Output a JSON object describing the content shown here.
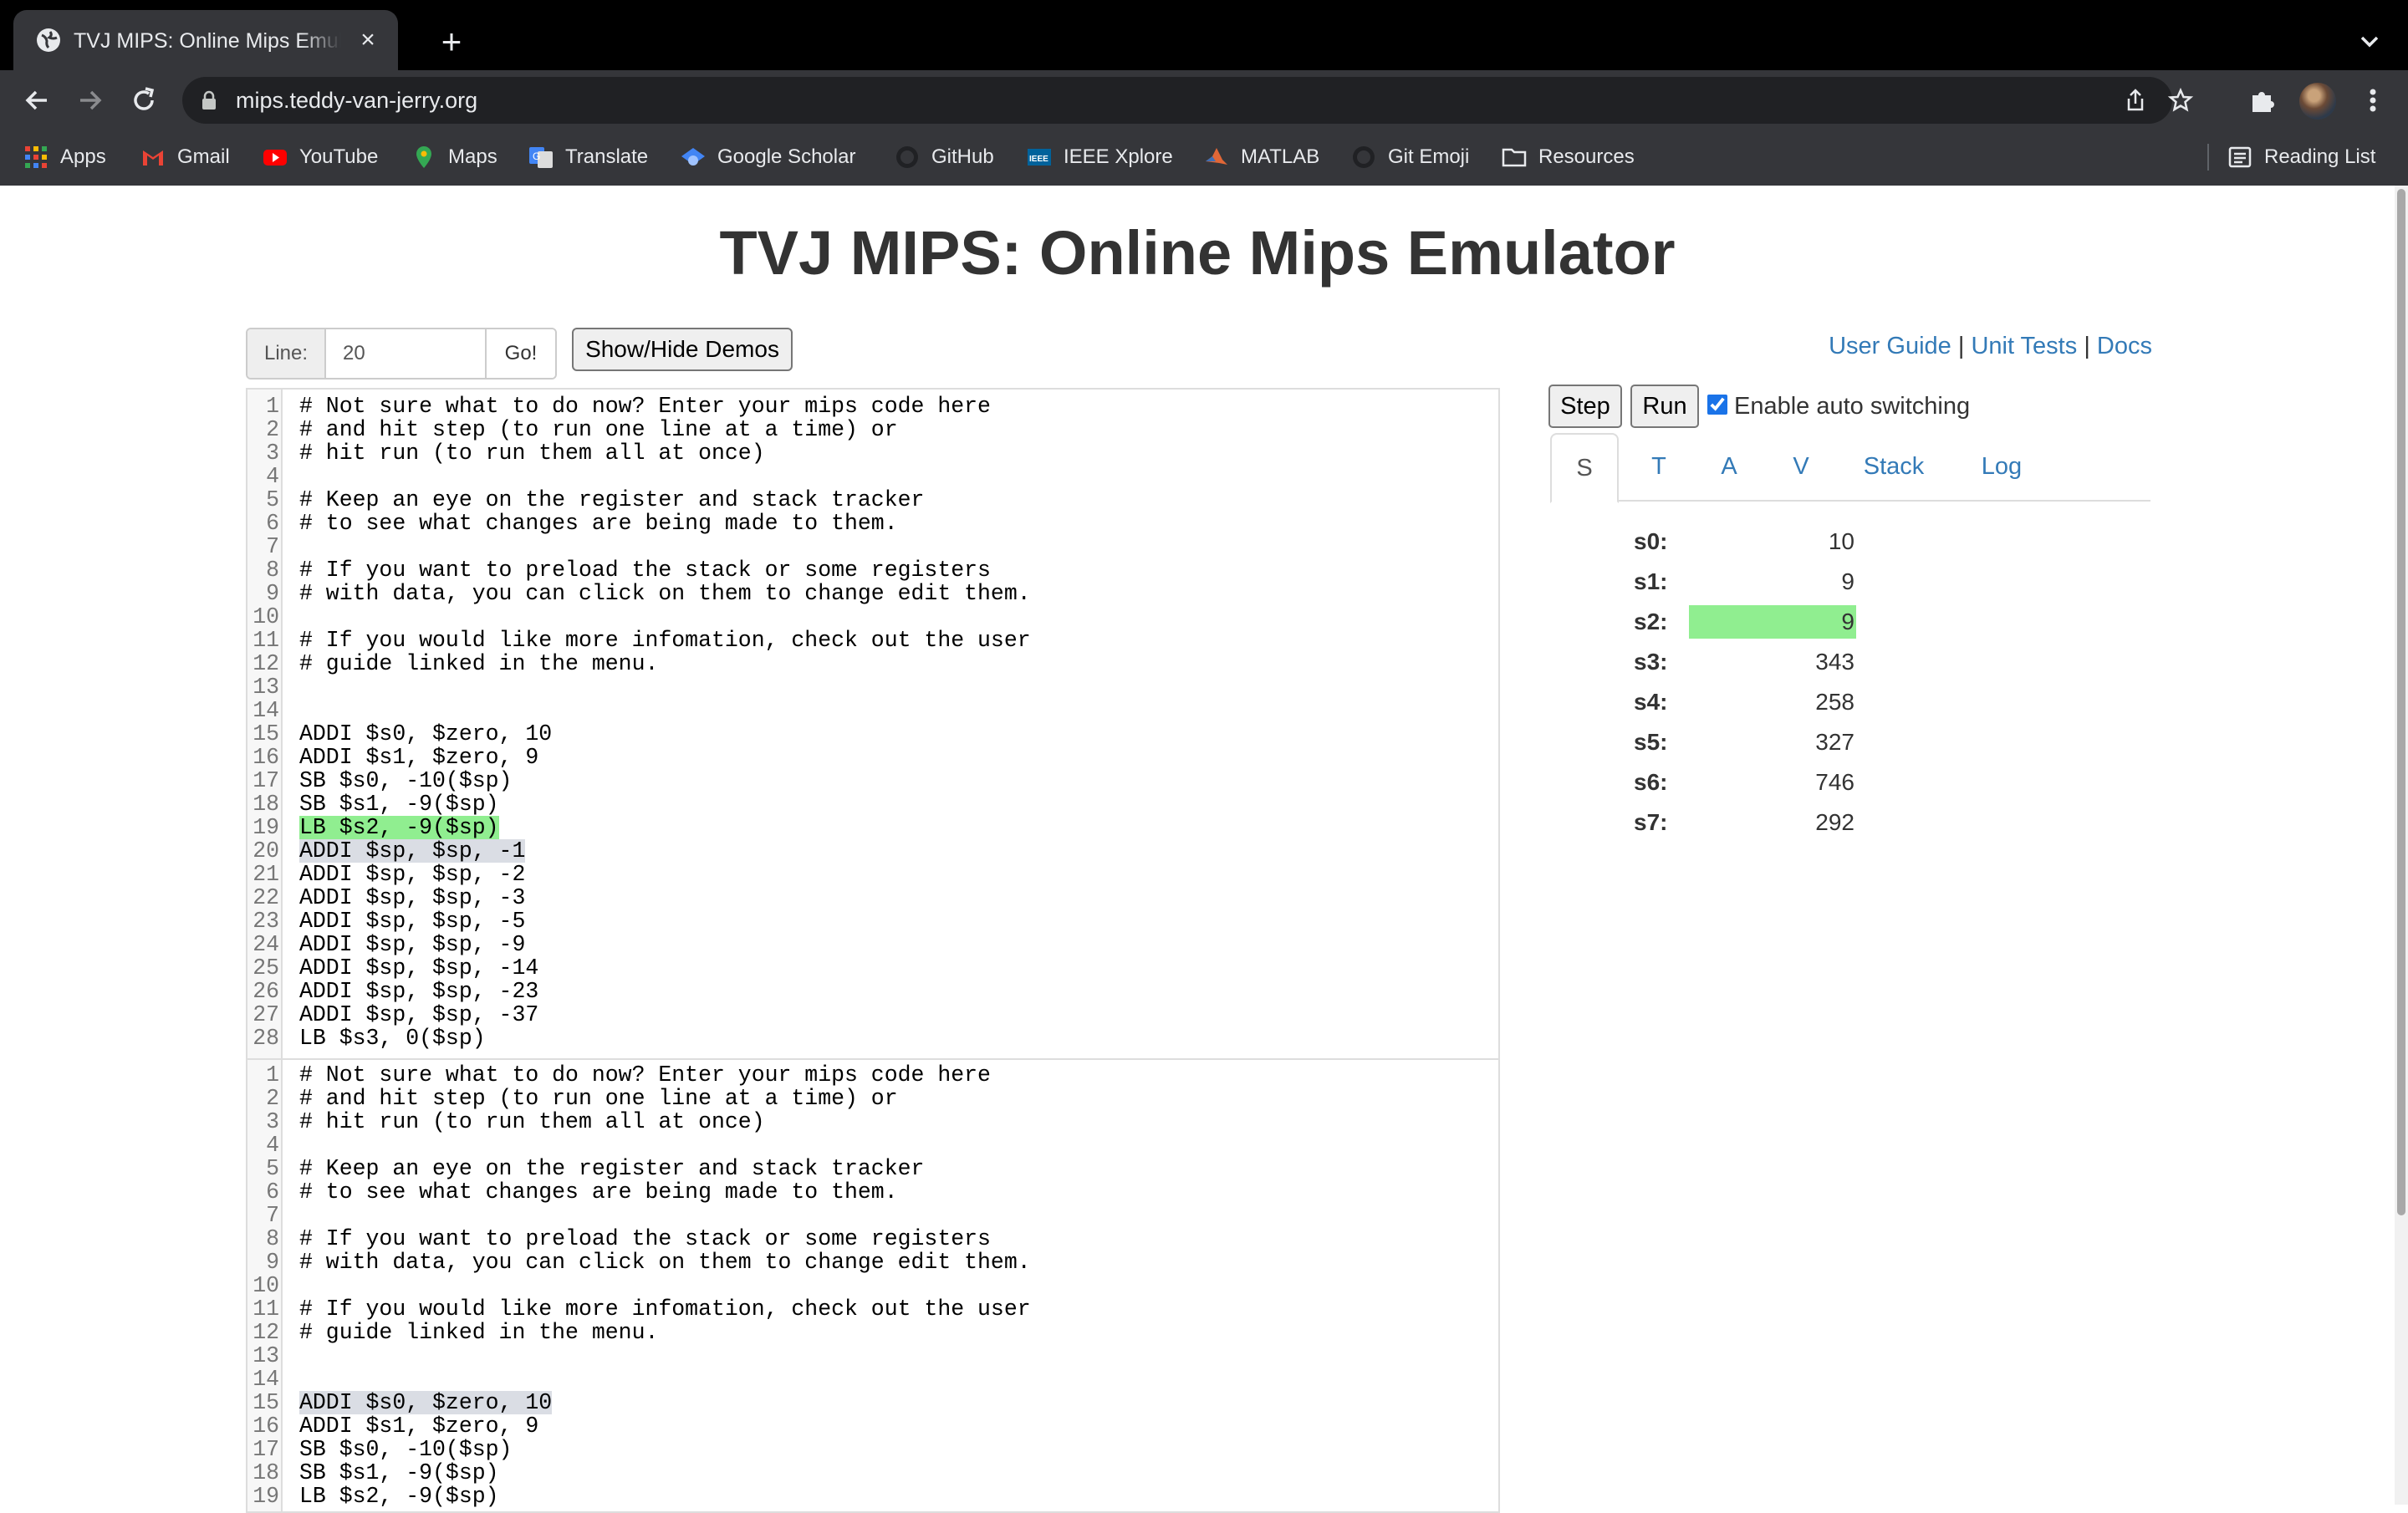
{
  "browser": {
    "tab_title": "TVJ MIPS: Online Mips Emulator",
    "new_tab": "+",
    "url": "mips.teddy-van-jerry.org",
    "bookmarks": [
      {
        "label": "Apps",
        "icon": "apps-grid-icon"
      },
      {
        "label": "Gmail",
        "icon": "gmail-icon"
      },
      {
        "label": "YouTube",
        "icon": "youtube-icon"
      },
      {
        "label": "Maps",
        "icon": "maps-icon"
      },
      {
        "label": "Translate",
        "icon": "translate-icon"
      },
      {
        "label": "Google Scholar",
        "icon": "scholar-icon"
      },
      {
        "label": "GitHub",
        "icon": "github-icon"
      },
      {
        "label": "IEEE Xplore",
        "icon": "ieee-icon"
      },
      {
        "label": "MATLAB",
        "icon": "matlab-icon"
      },
      {
        "label": "Git Emoji",
        "icon": "github-icon"
      },
      {
        "label": "Resources",
        "icon": "folder-icon"
      }
    ],
    "reading_list": "Reading List"
  },
  "page": {
    "title": "TVJ MIPS: Online Mips Emulator",
    "line_label": "Line:",
    "line_value": "20",
    "go_label": "Go!",
    "demos_label": "Show/Hide Demos",
    "links": {
      "user_guide": "User Guide",
      "unit_tests": "Unit Tests",
      "docs": "Docs",
      "sep": "|"
    }
  },
  "editor_main": {
    "lines": [
      "# Not sure what to do now? Enter your mips code here",
      "# and hit step (to run one line at a time) or",
      "# hit run (to run them all at once)",
      "",
      "# Keep an eye on the register and stack tracker",
      "# to see what changes are being made to them.",
      "",
      "# If you want to preload the stack or some registers",
      "# with data, you can click on them to change edit them.",
      "",
      "# If you would like more infomation, check out the user",
      "# guide linked in the menu.",
      "",
      "",
      "ADDI $s0, $zero, 10",
      "ADDI $s1, $zero, 9",
      "SB $s0, -10($sp)",
      "SB $s1, -9($sp)",
      "LB $s2, -9($sp)",
      "ADDI $sp, $sp, -1",
      "ADDI $sp, $sp, -2",
      "ADDI $sp, $sp, -3",
      "ADDI $sp, $sp, -5",
      "ADDI $sp, $sp, -9",
      "ADDI $sp, $sp, -14",
      "ADDI $sp, $sp, -23",
      "ADDI $sp, $sp, -37",
      "LB $s3, 0($sp)"
    ],
    "executed_line": 19,
    "current_line": 20
  },
  "editor_second": {
    "lines": [
      "# Not sure what to do now? Enter your mips code here",
      "# and hit step (to run one line at a time) or",
      "# hit run (to run them all at once)",
      "",
      "# Keep an eye on the register and stack tracker",
      "# to see what changes are being made to them.",
      "",
      "# If you want to preload the stack or some registers",
      "# with data, you can click on them to change edit them.",
      "",
      "# If you would like more infomation, check out the user",
      "# guide linked in the menu.",
      "",
      "",
      "ADDI $s0, $zero, 10",
      "ADDI $s1, $zero, 9",
      "SB $s0, -10($sp)",
      "SB $s1, -9($sp)",
      "LB $s2, -9($sp)"
    ],
    "current_line": 15
  },
  "controls": {
    "step_label": "Step",
    "run_label": "Run",
    "auto_switch_label": "Enable auto switching",
    "auto_switch_checked": true
  },
  "register_tabs": [
    {
      "label": "S",
      "active": true
    },
    {
      "label": "T",
      "active": false
    },
    {
      "label": "A",
      "active": false
    },
    {
      "label": "V",
      "active": false
    },
    {
      "label": "Stack",
      "active": false
    },
    {
      "label": "Log",
      "active": false
    }
  ],
  "registers": [
    {
      "name": "s0:",
      "value": "10",
      "changed": false
    },
    {
      "name": "s1:",
      "value": "9",
      "changed": false
    },
    {
      "name": "s2:",
      "value": "9",
      "changed": true
    },
    {
      "name": "s3:",
      "value": "343",
      "changed": false
    },
    {
      "name": "s4:",
      "value": "258",
      "changed": false
    },
    {
      "name": "s5:",
      "value": "327",
      "changed": false
    },
    {
      "name": "s6:",
      "value": "746",
      "changed": false
    },
    {
      "name": "s7:",
      "value": "292",
      "changed": false
    }
  ],
  "colors": {
    "highlight_executed": "#90ee90",
    "highlight_current": "#dadde4",
    "link": "#337ab7"
  }
}
